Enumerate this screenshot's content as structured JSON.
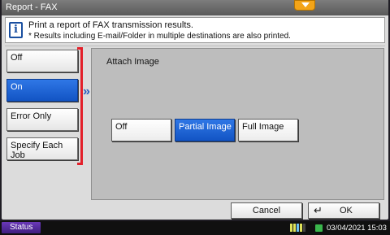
{
  "window": {
    "title": "Report - FAX"
  },
  "message": {
    "line1": "Print a report of FAX transmission results.",
    "line2": "* Results including E-mail/Folder in multiple destinations are also printed.",
    "icon": "info-icon"
  },
  "left_options": [
    {
      "label": "Off",
      "selected": false
    },
    {
      "label": "On",
      "selected": true
    },
    {
      "label": "Error Only",
      "selected": false
    },
    {
      "label": "Specify Each Job",
      "selected": false
    }
  ],
  "attach": {
    "label": "Attach Image",
    "options": [
      {
        "label": "Off",
        "selected": false
      },
      {
        "label": "Partial Image",
        "selected": true
      },
      {
        "label": "Full Image",
        "selected": false
      }
    ]
  },
  "footer": {
    "cancel_label": "Cancel",
    "ok_label": "OK"
  },
  "statusbar": {
    "status_label": "Status",
    "datetime": "03/04/2021  15:03"
  },
  "colors": {
    "selected": "#1a63d8",
    "bracket": "#e3202a",
    "notice": "#f3a418"
  }
}
